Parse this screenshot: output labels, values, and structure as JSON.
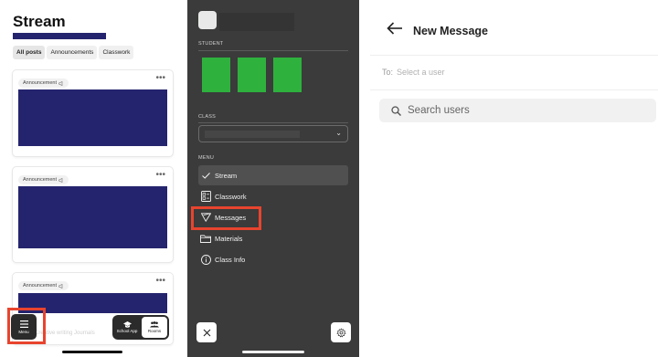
{
  "stream": {
    "title": "Stream",
    "tabs": [
      "All posts",
      "Announcements",
      "Classwork"
    ],
    "cards": [
      {
        "chip": "Announcement"
      },
      {
        "chip": "Announcement"
      },
      {
        "chip": "Announcement"
      }
    ],
    "faded_text": "Creative writing Journals",
    "menu_label": "Menu",
    "school_app_label": "School App",
    "rooms_label": "Rooms",
    "colors": {
      "accent": "#24246e",
      "highlight": "#e8442e"
    }
  },
  "drawer": {
    "student_label": "STUDENT",
    "class_label": "CLASS",
    "menu_label": "MENU",
    "items": [
      {
        "label": "Stream",
        "icon": "check-icon"
      },
      {
        "label": "Classwork",
        "icon": "classwork-icon"
      },
      {
        "label": "Messages",
        "icon": "send-icon"
      },
      {
        "label": "Materials",
        "icon": "folder-icon"
      },
      {
        "label": "Class Info",
        "icon": "info-icon"
      }
    ],
    "colors": {
      "background": "#3a3b3a",
      "student_tile": "#2fb13e"
    }
  },
  "message": {
    "title": "New Message",
    "to_label": "To:",
    "to_placeholder": "Select a user",
    "search_placeholder": "Search users"
  }
}
